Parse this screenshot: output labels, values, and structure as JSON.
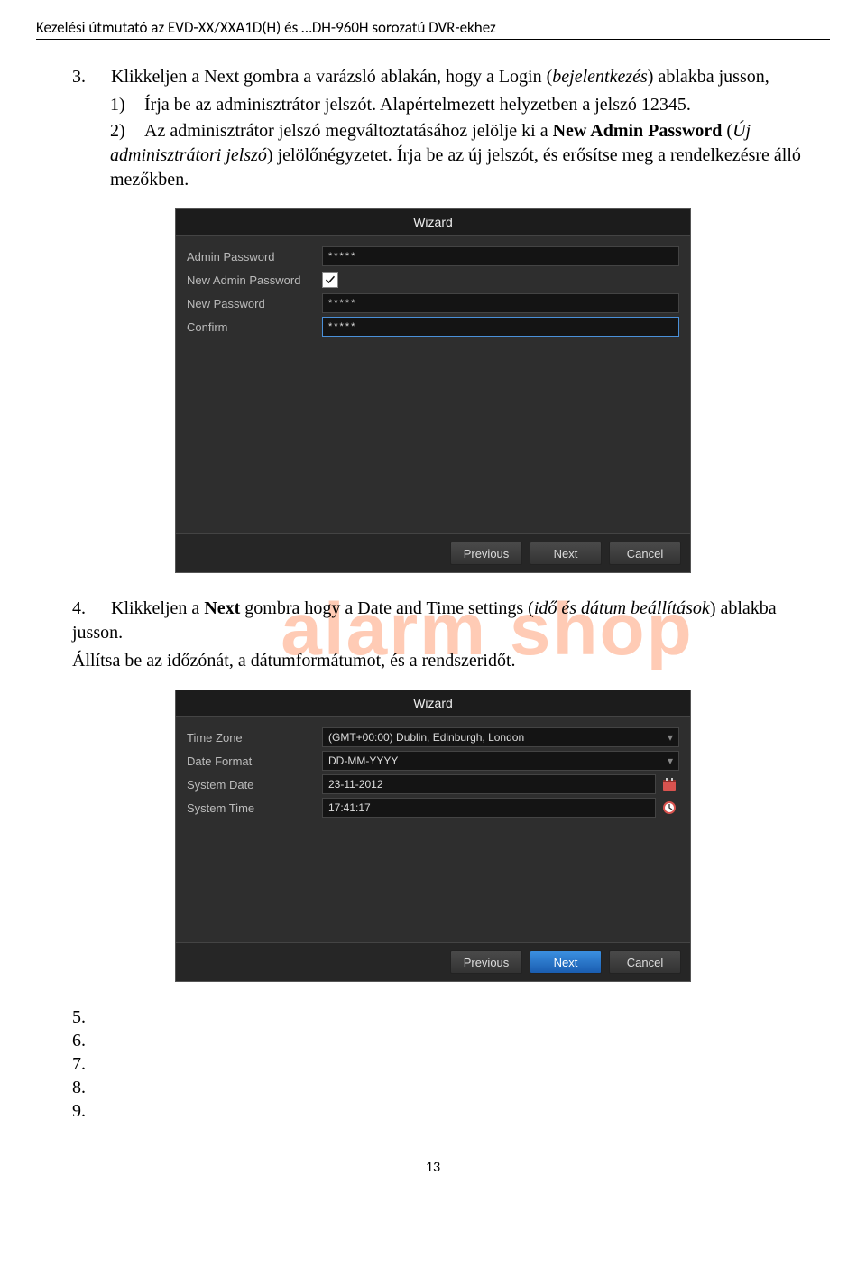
{
  "header": "Kezelési útmutató az EVD-XX/XXA1D(H) és …DH-960H sorozatú DVR-ekhez",
  "step3": {
    "num": "3.",
    "text": "Klikkeljen a Next gombra a varázsló ablakán, hogy a Login (",
    "italic1": "bejelentkezés",
    "text2": ") ablakba jusson,",
    "l1_num": "1)",
    "l1": "Írja be az adminisztrátor jelszót. Alapértelmezett helyzetben a jelszó 12345.",
    "l2_num": "2)",
    "l2a": "Az adminisztrátor jelszó megváltoztatásához jelölje ki a ",
    "l2b_bold": "New Admin Password",
    "l2c": " (",
    "l2c_italic": "Új adminisztrátori jelszó",
    "l2d": ") jelölőnégyzetet. Írja be az új jelszót, és erősítse meg a rendelkezésre álló mezőkben."
  },
  "wizard1": {
    "title": "Wizard",
    "rows": {
      "admin_pwd": "Admin Password",
      "new_admin_pwd": "New Admin Password",
      "new_pwd": "New Password",
      "confirm": "Confirm"
    },
    "mask": "*****",
    "mask2": "*****",
    "mask3": "*****",
    "checkbox_checked": true,
    "buttons": {
      "prev": "Previous",
      "next": "Next",
      "cancel": "Cancel"
    }
  },
  "step4": {
    "num": "4.",
    "text1": "Klikkeljen a ",
    "bold": "Next",
    "text2": " gombra hogy a Date and Time settings (",
    "italic": "idő és dátum beállítások",
    "text3": ") ablakba jusson.",
    "line2": "Állítsa be az időzónát, a dátumformátumot, és a rendszeridőt."
  },
  "watermark": "alarm shop",
  "wizard2": {
    "title": "Wizard",
    "rows": {
      "tz_lbl": "Time Zone",
      "tz_val": "(GMT+00:00) Dublin, Edinburgh, London",
      "df_lbl": "Date Format",
      "df_val": "DD-MM-YYYY",
      "sd_lbl": "System Date",
      "sd_val": "23-11-2012",
      "st_lbl": "System Time",
      "st_val": "17:41:17"
    },
    "buttons": {
      "prev": "Previous",
      "next": "Next",
      "cancel": "Cancel"
    }
  },
  "tail": {
    "n5": "5.",
    "n6": "6.",
    "n7": "7.",
    "n8": "8.",
    "n9": "9."
  },
  "page_num": "13"
}
